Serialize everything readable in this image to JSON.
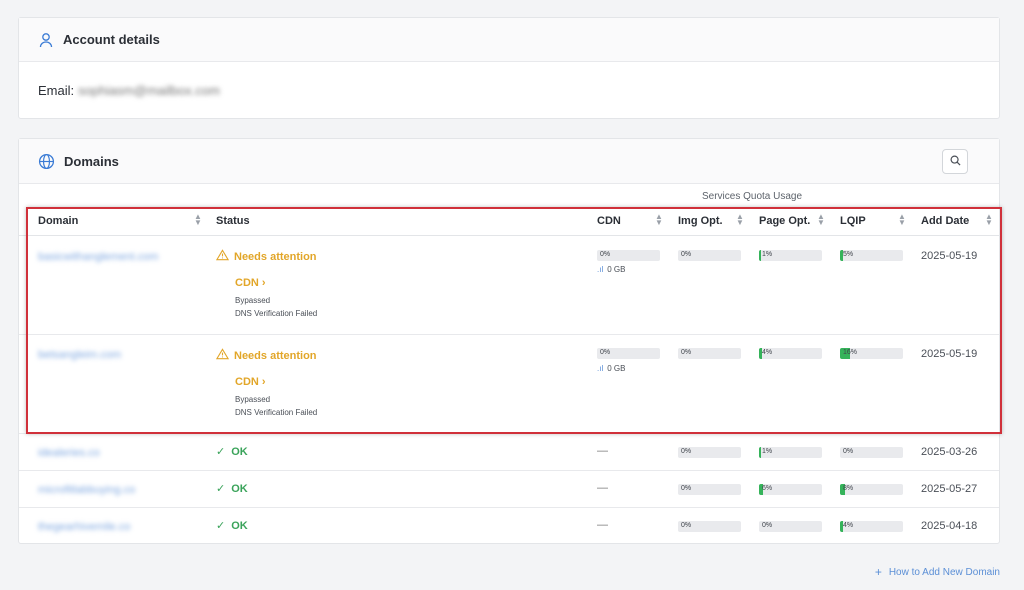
{
  "account": {
    "title": "Account details",
    "email_label": "Email:",
    "email_value": "sophiasm@mailbox.com"
  },
  "domains": {
    "title": "Domains",
    "quota_label": "Services Quota Usage",
    "columns": {
      "domain": "Domain",
      "status": "Status",
      "cdn": "CDN",
      "img": "Img Opt.",
      "page": "Page Opt.",
      "lqip": "LQIP",
      "date": "Add Date"
    },
    "rows": [
      {
        "domain": "basicwithanglement.com",
        "status": "Needs attention",
        "status_type": "warn",
        "detail_link": "CDN",
        "detail_line1": "Bypassed",
        "detail_line2": "DNS Verification Failed",
        "cdn": "0%",
        "cdn_fill": 0,
        "bandwidth": "0 GB",
        "img": "0%",
        "img_fill": 0,
        "page": "1%",
        "page_fill": 1,
        "lqip": "5%",
        "lqip_fill": 5,
        "date": "2025-05-19"
      },
      {
        "domain": "betsangleim.com",
        "status": "Needs attention",
        "status_type": "warn",
        "detail_link": "CDN",
        "detail_line1": "Bypassed",
        "detail_line2": "DNS Verification Failed",
        "cdn": "0%",
        "cdn_fill": 0,
        "bandwidth": "0 GB",
        "img": "0%",
        "img_fill": 0,
        "page": "4%",
        "page_fill": 4,
        "lqip": "16%",
        "lqip_fill": 16,
        "date": "2025-05-19"
      },
      {
        "domain": "idealeries.co",
        "status": "OK",
        "status_type": "ok",
        "cdn": "—",
        "img": "0%",
        "img_fill": 0,
        "page": "1%",
        "page_fill": 1,
        "lqip": "0%",
        "lqip_fill": 0,
        "date": "2025-03-26"
      },
      {
        "domain": "microfitlabbuying.co",
        "status": "OK",
        "status_type": "ok",
        "cdn": "—",
        "img": "0%",
        "img_fill": 0,
        "page": "6%",
        "page_fill": 6,
        "lqip": "8%",
        "lqip_fill": 8,
        "date": "2025-05-27"
      },
      {
        "domain": "thegearhivemile.co",
        "status": "OK",
        "status_type": "ok",
        "cdn": "—",
        "img": "0%",
        "img_fill": 0,
        "page": "0%",
        "page_fill": 0,
        "lqip": "4%",
        "lqip_fill": 4,
        "date": "2025-04-18"
      }
    ]
  },
  "footer": {
    "add_link": "How to Add New Domain"
  },
  "colors": {
    "warn": "#e2a629",
    "ok": "#3aa35a",
    "bar_fill": "#35b35a",
    "link": "#5b8fd6",
    "highlight": "#d0303a"
  }
}
